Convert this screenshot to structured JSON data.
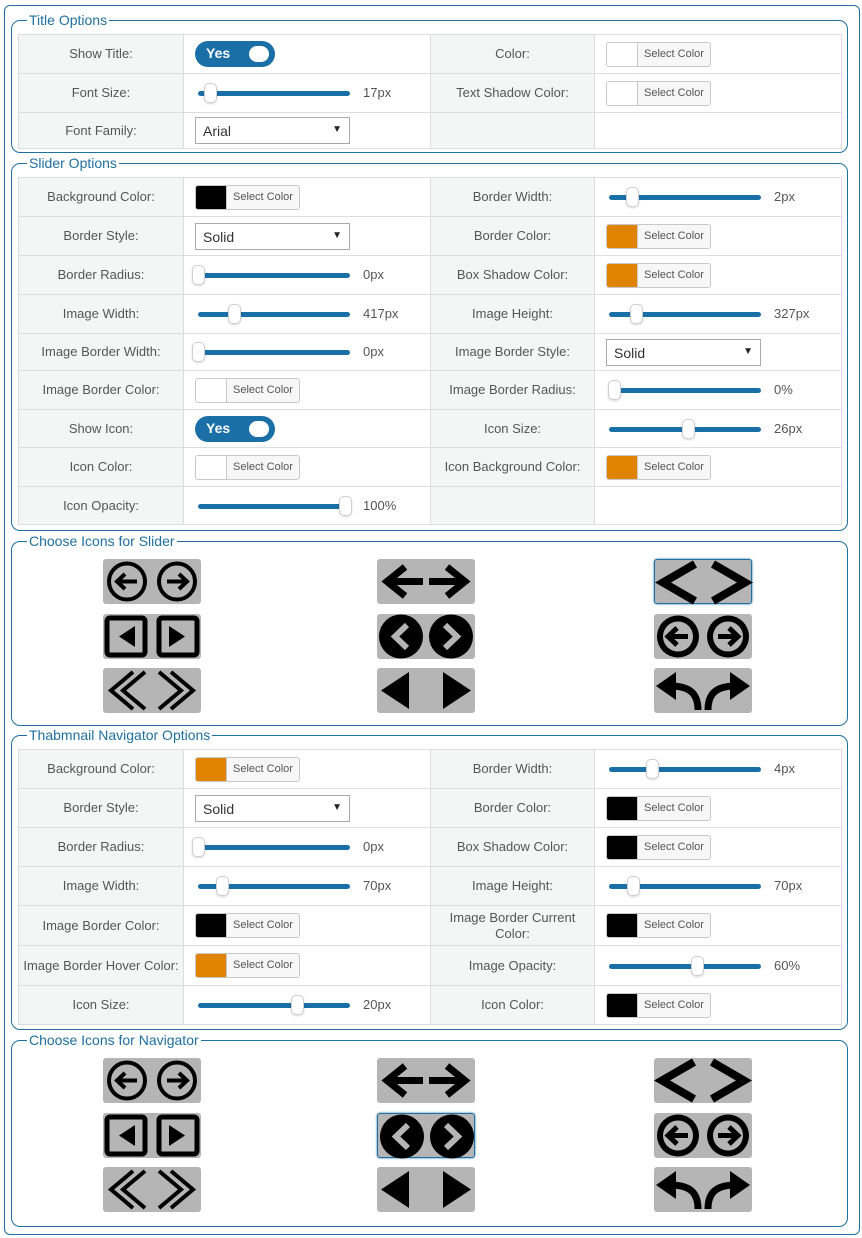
{
  "title_options": {
    "legend": "Title Options",
    "show_title_label": "Show Title:",
    "show_title_value": "Yes",
    "color_label": "Color:",
    "color_value": "#ffffff",
    "color_button": "Select Color",
    "font_size_label": "Font Size:",
    "font_size_value": "17px",
    "font_size_level": 0.08,
    "text_shadow_color_label": "Text Shadow Color:",
    "text_shadow_color_value": "#ffffff",
    "text_shadow_color_button": "Select Color",
    "font_family_label": "Font Family:",
    "font_family_value": "Arial"
  },
  "slider_options": {
    "legend": "Slider Options",
    "background_color_label": "Background Color:",
    "background_color_value": "#000000",
    "background_color_button": "Select Color",
    "border_width_label": "Border Width:",
    "border_width_value": "2px",
    "border_width_level": 0.15,
    "border_style_label": "Border Style:",
    "border_style_value": "Solid",
    "border_color_label": "Border Color:",
    "border_color_value": "#e08300",
    "border_color_button": "Select Color",
    "border_radius_label": "Border Radius:",
    "border_radius_value": "0px",
    "border_radius_level": 0.0,
    "box_shadow_color_label": "Box Shadow Color:",
    "box_shadow_color_value": "#e08300",
    "box_shadow_color_button": "Select Color",
    "image_width_label": "Image Width:",
    "image_width_value": "417px",
    "image_width_level": 0.24,
    "image_height_label": "Image Height:",
    "image_height_value": "327px",
    "image_height_level": 0.18,
    "image_border_width_label": "Image Border Width:",
    "image_border_width_value": "0px",
    "image_border_width_level": 0.0,
    "image_border_style_label": "Image Border Style:",
    "image_border_style_value": "Solid",
    "image_border_color_label": "Image Border Color:",
    "image_border_color_value": "#ffffff",
    "image_border_color_button": "Select Color",
    "image_border_radius_label": "Image Border Radius:",
    "image_border_radius_value": "0%",
    "image_border_radius_level": 0.03,
    "show_icon_label": "Show Icon:",
    "show_icon_value": "Yes",
    "icon_size_label": "Icon Size:",
    "icon_size_value": "26px",
    "icon_size_level": 0.52,
    "icon_color_label": "Icon Color:",
    "icon_color_value": "#ffffff",
    "icon_color_button": "Select Color",
    "icon_background_color_label": "Icon Background Color:",
    "icon_background_color_value": "#e08300",
    "icon_background_color_button": "Select Color",
    "icon_opacity_label": "Icon Opacity:",
    "icon_opacity_value": "100%",
    "icon_opacity_level": 0.97
  },
  "slider_icons": {
    "legend": "Choose Icons for Slider",
    "icons": [
      "circle-arrows-icon",
      "bold-arrows-icon",
      "chevrons-icon",
      "square-triangles-icon",
      "filled-circle-chevrons-icon",
      "filled-circle-arrows-icon",
      "double-chevrons-icon",
      "triangles-icon",
      "curved-arrows-icon"
    ],
    "selected_index": 2
  },
  "navigator_options": {
    "legend": "Thabmnail Navigator Options",
    "background_color_label": "Background Color:",
    "background_color_value": "#e08300",
    "background_color_button": "Select Color",
    "border_width_label": "Border Width:",
    "border_width_value": "4px",
    "border_width_level": 0.28,
    "border_style_label": "Border Style:",
    "border_style_value": "Solid",
    "border_color_label": "Border Color:",
    "border_color_value": "#000000",
    "border_color_button": "Select Color",
    "border_radius_label": "Border Radius:",
    "border_radius_value": "0px",
    "border_radius_level": 0.0,
    "box_shadow_color_label": "Box Shadow Color:",
    "box_shadow_color_value": "#000000",
    "box_shadow_color_button": "Select Color",
    "image_width_label": "Image Width:",
    "image_width_value": "70px",
    "image_width_level": 0.16,
    "image_height_label": "Image Height:",
    "image_height_value": "70px",
    "image_height_level": 0.16,
    "image_border_color_label": "Image Border Color:",
    "image_border_color_value": "#000000",
    "image_border_color_button": "Select Color",
    "image_border_current_color_label": "Image Border Current Color:",
    "image_border_current_color_value": "#000000",
    "image_border_current_color_button": "Select Color",
    "image_border_hover_color_label": "Image Border Hover Color:",
    "image_border_hover_color_value": "#e08300",
    "image_border_hover_color_button": "Select Color",
    "image_opacity_label": "Image Opacity:",
    "image_opacity_value": "60%",
    "image_opacity_level": 0.58,
    "icon_size_label": "Icon Size:",
    "icon_size_value": "20px",
    "icon_size_level": 0.65,
    "icon_color_label": "Icon Color:",
    "icon_color_value": "#000000",
    "icon_color_button": "Select Color"
  },
  "navigator_icons": {
    "legend": "Choose Icons for Navigator",
    "icons": [
      "circle-arrows-icon",
      "bold-arrows-icon",
      "chevrons-icon",
      "square-triangles-icon",
      "filled-circle-chevrons-icon",
      "filled-circle-arrows-icon",
      "double-chevrons-icon",
      "triangles-icon",
      "curved-arrows-icon"
    ],
    "selected_index": 4
  }
}
